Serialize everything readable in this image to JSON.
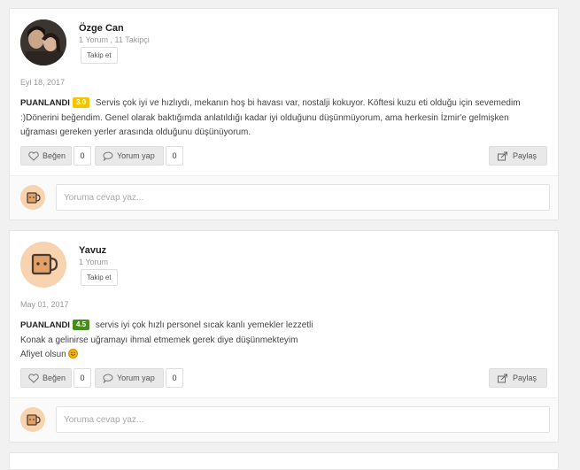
{
  "reviews": [
    {
      "user": {
        "name": "Özge Can",
        "stats": "1 Yorum , 11 Takipçi",
        "avatar": "user-photo"
      },
      "follow_label": "Takip et",
      "date": "Eyl 18, 2017",
      "rating_label": "PUANLANDI",
      "rating": "3.0",
      "rating_color": "#f2c500",
      "text": "Servis çok iyi ve hızlıydı, mekanın hoş bi havası var, nostalji kokuyor. Köftesi kuzu eti olduğu için sevemedim :)Dönerini beğendim. Genel olarak baktığımda anlatıldığı kadar iyi olduğunu düşünmüyorum, ama herkesin İzmir'e gelmişken uğraması gereken yerler arasında olduğunu düşünüyorum.",
      "like_label": "Beğen",
      "like_count": "0",
      "comment_label": "Yorum yap",
      "comment_count": "0",
      "share_label": "Paylaş",
      "reply_placeholder": "Yoruma cevap yaz..."
    },
    {
      "user": {
        "name": "Yavuz",
        "stats": "1 Yorum",
        "avatar": "coffee-mug-icon"
      },
      "follow_label": "Takip et",
      "date": "May 01, 2017",
      "rating_label": "PUANLANDI",
      "rating": "4.5",
      "rating_color": "#4a8b1f",
      "text_lines": [
        "servis iyi çok hızlı personel sıcak kanlı yemekler lezzetli",
        "Konak a gelinirse uğramayı ihmal etmemek gerek diye düşünmekteyim",
        "Afiyet olsun"
      ],
      "like_label": "Beğen",
      "like_count": "0",
      "comment_label": "Yorum yap",
      "comment_count": "0",
      "share_label": "Paylaş",
      "reply_placeholder": "Yoruma cevap yaz..."
    }
  ]
}
